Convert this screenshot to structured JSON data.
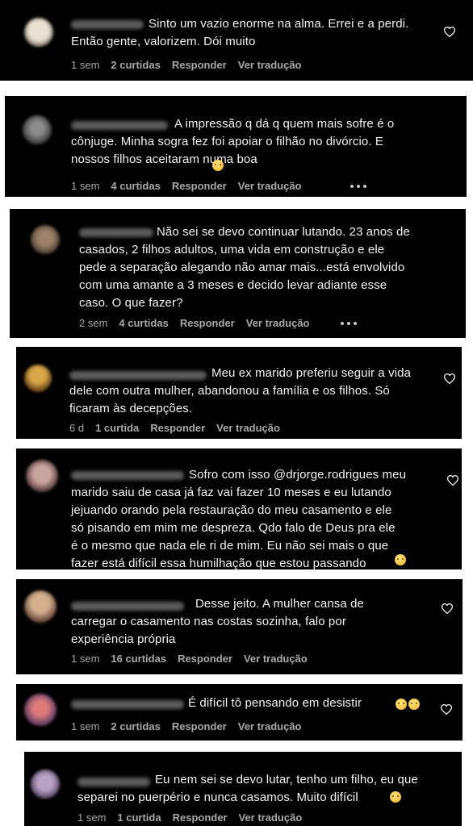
{
  "meta_labels": {
    "likes_suffix": "curtidas",
    "like_single": "curtida",
    "reply": "Responder",
    "translate": "Ver tradução"
  },
  "comments": [
    {
      "text": "Sinto um vazio enorme na alma. Errei e a perdi.\nEntão gente, valorizem. Dói muito",
      "time": "1 sem",
      "likes": "2 curtidas",
      "reply": "Responder",
      "translate": "Ver tradução"
    },
    {
      "text": "A impressão q dá q quem mais sofre é o\ncônjuge. Minha sogra fez foi apoiar o filhão no divórcio. E\nnossos filhos aceitaram numa boa",
      "time": "1 sem",
      "likes": "4 curtidas",
      "reply": "Responder",
      "translate": "Ver tradução"
    },
    {
      "text": "Não sei se devo continuar lutando. 23 anos de\ncasados, 2 filhos adultos, uma vida em construção e ele\npede a separação alegando não amar mais...está envolvido\ncom uma amante a 3 meses e decido levar adiante esse\ncaso. O que fazer?",
      "time": "2 sem",
      "likes": "4 curtidas",
      "reply": "Responder",
      "translate": "Ver tradução"
    },
    {
      "text": "Meu ex marido preferiu seguir a vida\ndele com outra mulher, abandonou a família e os filhos. Só\nficaram às decepções.",
      "time": "6 d",
      "likes": "1 curtida",
      "reply": "Responder",
      "translate": "Ver tradução"
    },
    {
      "text": "Sofro com isso @drjorge.rodrigues meu\nmarido saiu de casa já faz vai fazer 10 meses e eu lutando\njejuando orando pela restauração do meu casamento e ele\nsó pisando em mim me despreza. Qdo falo de Deus pra ele\né o mesmo que nada ele ri de mim. Eu não sei mais o que\nfazer está difícil essa humilhação que estou passando",
      "time": "",
      "likes": "",
      "reply": "",
      "translate": ""
    },
    {
      "text": "Desse jeito. A mulher cansa de\ncarregar o casamento nas costas sozinha, falo por\nexperiência própria",
      "time": "1 sem",
      "likes": "16 curtidas",
      "reply": "Responder",
      "translate": "Ver tradução"
    },
    {
      "text": "É difícil tô pensando em desistir",
      "time": "1 sem",
      "likes": "2 curtidas",
      "reply": "Responder",
      "translate": "Ver tradução"
    },
    {
      "text": "Eu nem sei se devo lutar, tenho um filho, eu que\nseparei no puerpério e nunca casamos. Muito difícil",
      "time": "1 sem",
      "likes": "1 curtida",
      "reply": "Responder",
      "translate": "Ver tradução"
    }
  ],
  "colors": {
    "card_bg": "#000000",
    "text": "#f2f2f2",
    "meta": "#a8a8a8",
    "page_bg": "#ffffff"
  },
  "icons": {
    "heart": "heart-outline-icon",
    "more": "more-options-icon"
  }
}
